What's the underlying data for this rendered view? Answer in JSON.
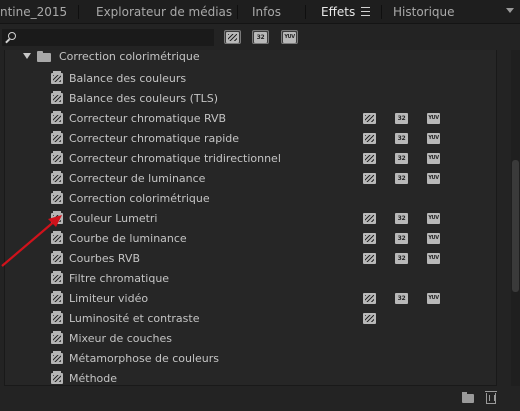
{
  "tabs": [
    {
      "label": "ntine_2015",
      "active": false
    },
    {
      "label": "Explorateur de médias",
      "active": false
    },
    {
      "label": "Infos",
      "active": false
    },
    {
      "label": "Effets",
      "active": true
    },
    {
      "label": "Historique",
      "active": false
    }
  ],
  "search": {
    "value": "",
    "placeholder": ""
  },
  "filters": [
    {
      "name": "accelerated-effects",
      "label": ""
    },
    {
      "name": "32-bit-color",
      "label": "32"
    },
    {
      "name": "yuv-effects",
      "label": "YUV"
    }
  ],
  "folder": {
    "label": "Correction colorimétrique",
    "expanded": true
  },
  "effects": [
    {
      "label": "Balance des couleurs",
      "accel": false,
      "b32": false,
      "yuv": false
    },
    {
      "label": "Balance des couleurs (TLS)",
      "accel": false,
      "b32": false,
      "yuv": false
    },
    {
      "label": "Correcteur chromatique RVB",
      "accel": true,
      "b32": true,
      "yuv": true
    },
    {
      "label": "Correcteur chromatique rapide",
      "accel": true,
      "b32": true,
      "yuv": true
    },
    {
      "label": "Correcteur chromatique tridirectionnel",
      "accel": true,
      "b32": true,
      "yuv": true
    },
    {
      "label": "Correcteur de luminance",
      "accel": true,
      "b32": true,
      "yuv": true
    },
    {
      "label": "Correction colorimétrique",
      "accel": false,
      "b32": false,
      "yuv": false
    },
    {
      "label": "Couleur Lumetri",
      "accel": true,
      "b32": true,
      "yuv": true
    },
    {
      "label": "Courbe de luminance",
      "accel": true,
      "b32": true,
      "yuv": true
    },
    {
      "label": "Courbes RVB",
      "accel": true,
      "b32": true,
      "yuv": true
    },
    {
      "label": "Filtre chromatique",
      "accel": false,
      "b32": false,
      "yuv": false
    },
    {
      "label": "Limiteur vidéo",
      "accel": true,
      "b32": true,
      "yuv": true
    },
    {
      "label": "Luminosité et contraste",
      "accel": true,
      "b32": false,
      "yuv": false
    },
    {
      "label": "Mixeur de couches",
      "accel": false,
      "b32": false,
      "yuv": false
    },
    {
      "label": "Métamorphose de couleurs",
      "accel": false,
      "b32": false,
      "yuv": false
    },
    {
      "label": "Méthode",
      "accel": false,
      "b32": false,
      "yuv": false
    }
  ],
  "badge_text": {
    "b32": "32",
    "yuv": "YUV"
  },
  "colors": {
    "annotation": "#d0121b",
    "active_tab": "#e8e8e8",
    "panel_bg": "#262626"
  }
}
